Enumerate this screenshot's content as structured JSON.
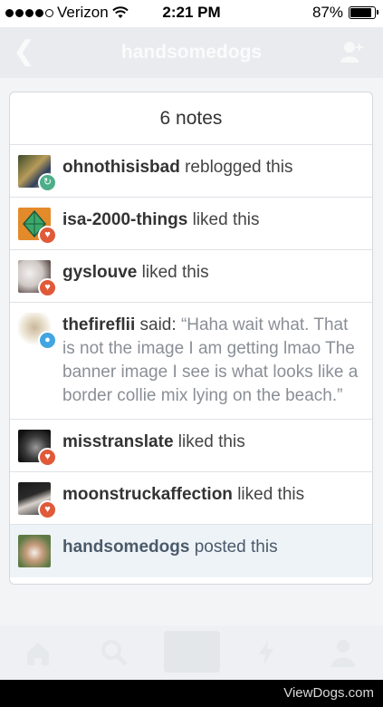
{
  "status_bar": {
    "carrier": "Verizon",
    "time": "2:21 PM",
    "battery": "87%",
    "battery_level": 0.87
  },
  "nav": {
    "title": "handsomedogs"
  },
  "notes": {
    "title": "6 notes",
    "items": [
      {
        "user": "ohnothisisbad",
        "action": "reblogged this",
        "type": "reblog"
      },
      {
        "user": "isa-2000-things",
        "action": "liked this",
        "type": "like"
      },
      {
        "user": "gyslouve",
        "action": "liked this",
        "type": "like"
      },
      {
        "user": "thefireflii",
        "action": "said:",
        "quote": "“Haha wait what. That is not the image I am getting lmao The banner image I see is what looks like a border collie mix lying on the beach.”",
        "type": "reply"
      },
      {
        "user": "misstranslate",
        "action": "liked this",
        "type": "like"
      },
      {
        "user": "moonstruckaffection",
        "action": "liked this",
        "type": "like"
      },
      {
        "user": "handsomedogs",
        "action": "posted this",
        "type": "post"
      }
    ]
  },
  "watermark": "ViewDogs.com",
  "colors": {
    "like": "#e05a3a",
    "reblog": "#4caf8a",
    "reply": "#41a5e0"
  }
}
